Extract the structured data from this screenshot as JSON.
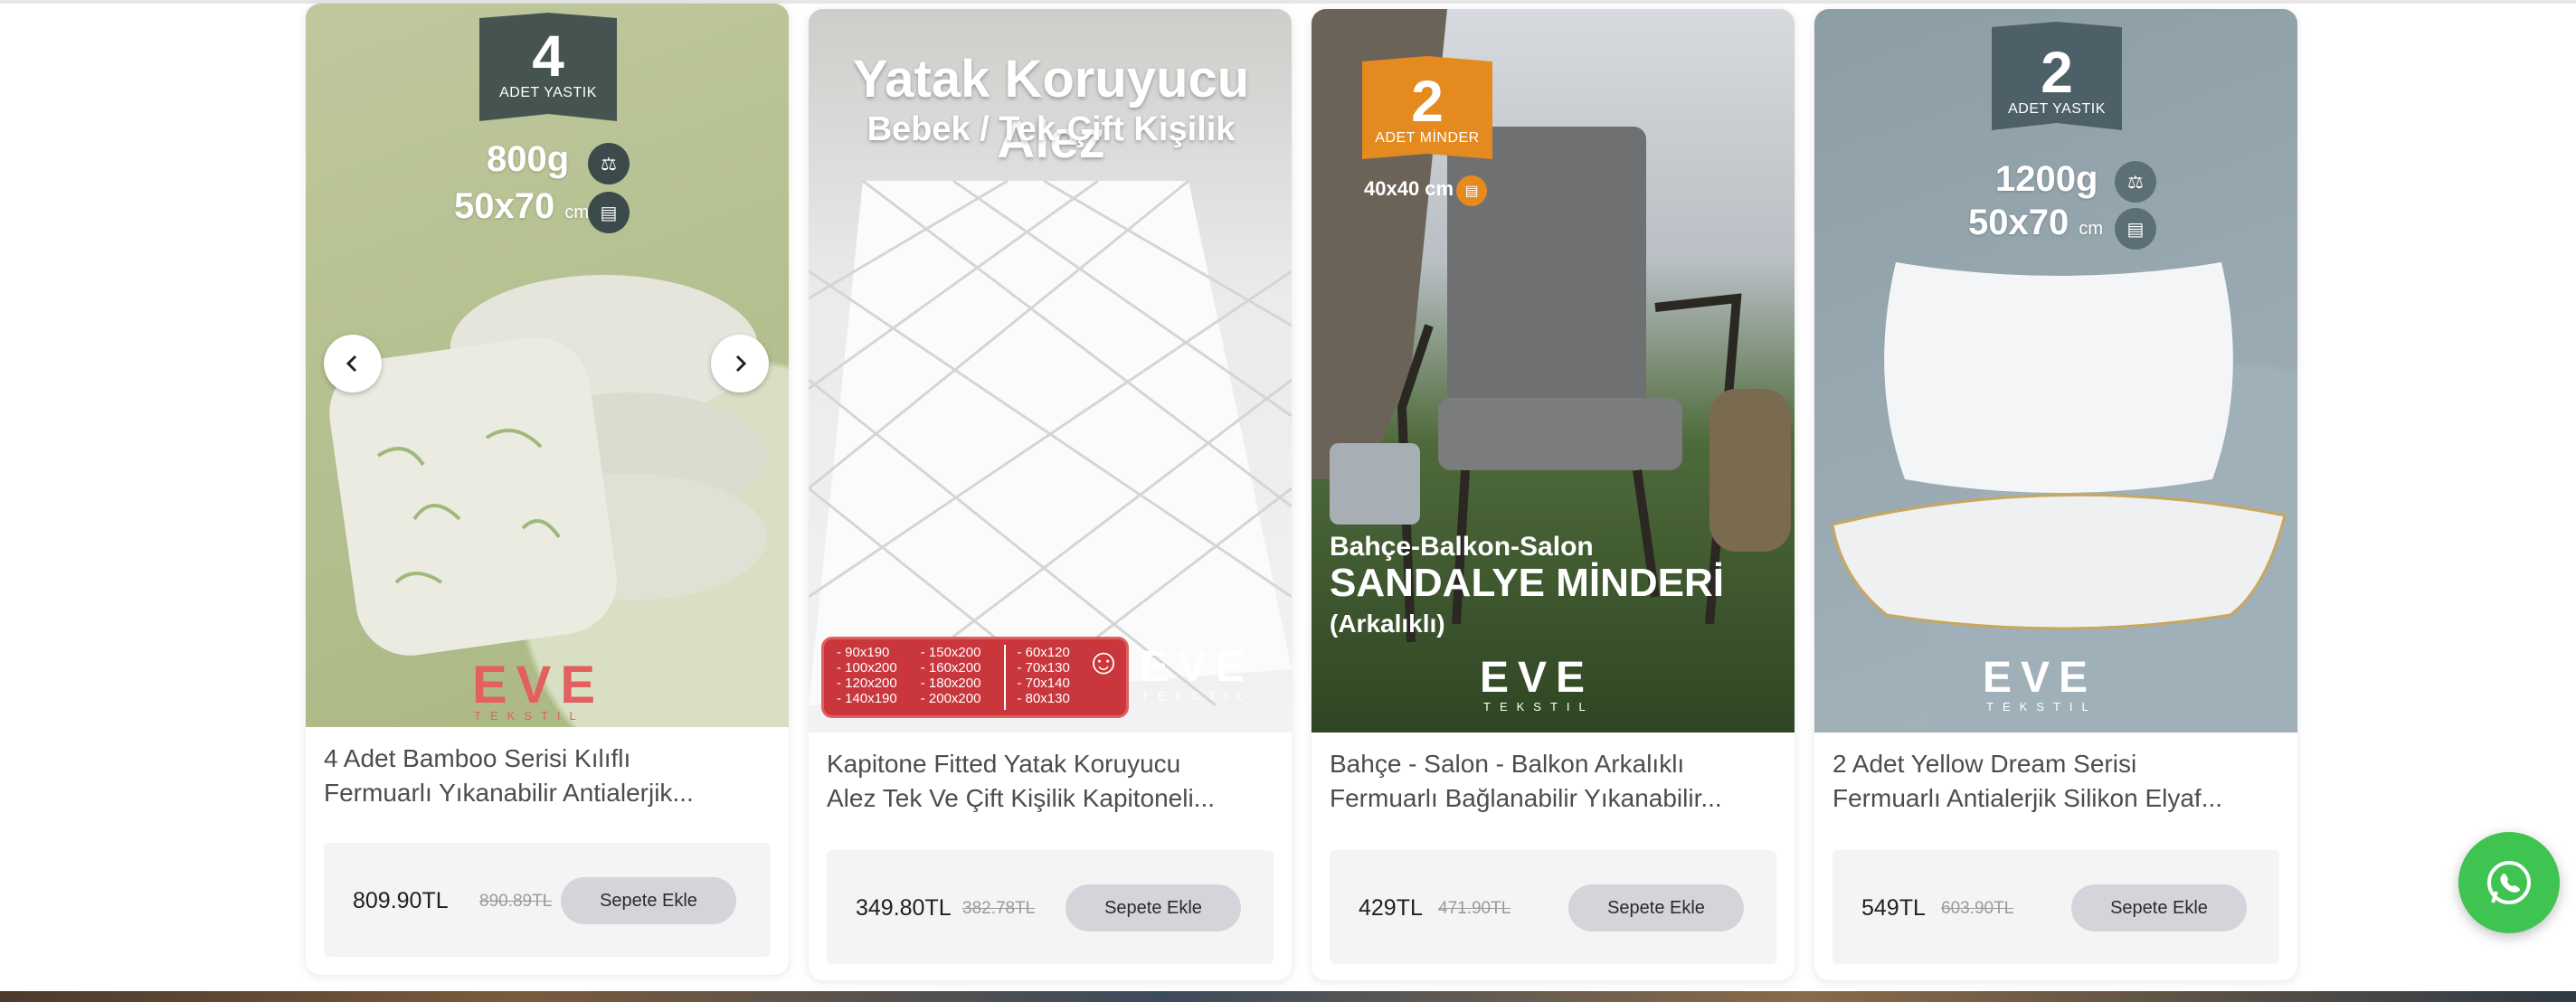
{
  "colors": {
    "whatsapp": "#3fc351",
    "button_bg": "#d4d5da",
    "price_box": "#f4f4f5"
  },
  "products": [
    {
      "title": "4 Adet Bamboo Serisi Kılıflı\nFermuarlı Yıkanabilir Antialerjik...",
      "price": "809.90TL",
      "old_price": "890.89TL",
      "button": "Sepete Ekle",
      "image": {
        "badge_number": "4",
        "badge_label": "ADET YASTIK",
        "weight": "800g",
        "size": "50x70",
        "unit": "cm",
        "logo": "EVE",
        "logo_sub": "TEKSTIL"
      }
    },
    {
      "title": "Kapitone Fitted Yatak Koruyucu\nAlez Tek Ve Çift Kişilik Kapitoneli...",
      "price": "349.80TL",
      "old_price": "382.78TL",
      "button": "Sepete Ekle",
      "image": {
        "headline": "Yatak Koruyucu Alez",
        "subheadline": "Bebek / Tek-Çift Kişilik",
        "sizes_col1": [
          "- 90x190",
          "- 100x200",
          "- 120x200",
          "- 140x190"
        ],
        "sizes_col2": [
          "- 150x200",
          "- 160x200",
          "- 180x200",
          "- 200x200"
        ],
        "sizes_col3": [
          "- 60x120",
          "- 70x130",
          "- 70x140",
          "- 80x130"
        ],
        "logo": "EVE",
        "logo_sub": "TEKSTIL"
      }
    },
    {
      "title": "Bahçe - Salon - Balkon Arkalıklı\nFermuarlı Bağlanabilir Yıkanabilir...",
      "price": "429TL",
      "old_price": "471.90TL",
      "button": "Sepete Ekle",
      "image": {
        "badge_number": "2",
        "badge_label": "ADET MİNDER",
        "size": "40x40 cm",
        "line1": "Bahçe-Balkon-Salon",
        "line2": "SANDALYE MİNDERİ",
        "line3": "(Arkalıklı)",
        "logo": "EVE",
        "logo_sub": "TEKSTIL"
      }
    },
    {
      "title": "2 Adet Yellow Dream Serisi\nFermuarlı Antialerjik Silikon Elyaf...",
      "price": "549TL",
      "old_price": "603.90TL",
      "button": "Sepete Ekle",
      "image": {
        "badge_number": "2",
        "badge_label": "ADET YASTIK",
        "weight": "1200g",
        "size": "50x70",
        "unit": "cm",
        "logo": "EVE",
        "logo_sub": "TEKSTIL"
      }
    }
  ],
  "icons": {
    "prev": "chevron-left-icon",
    "next": "chevron-right-icon",
    "whatsapp": "whatsapp-icon"
  }
}
